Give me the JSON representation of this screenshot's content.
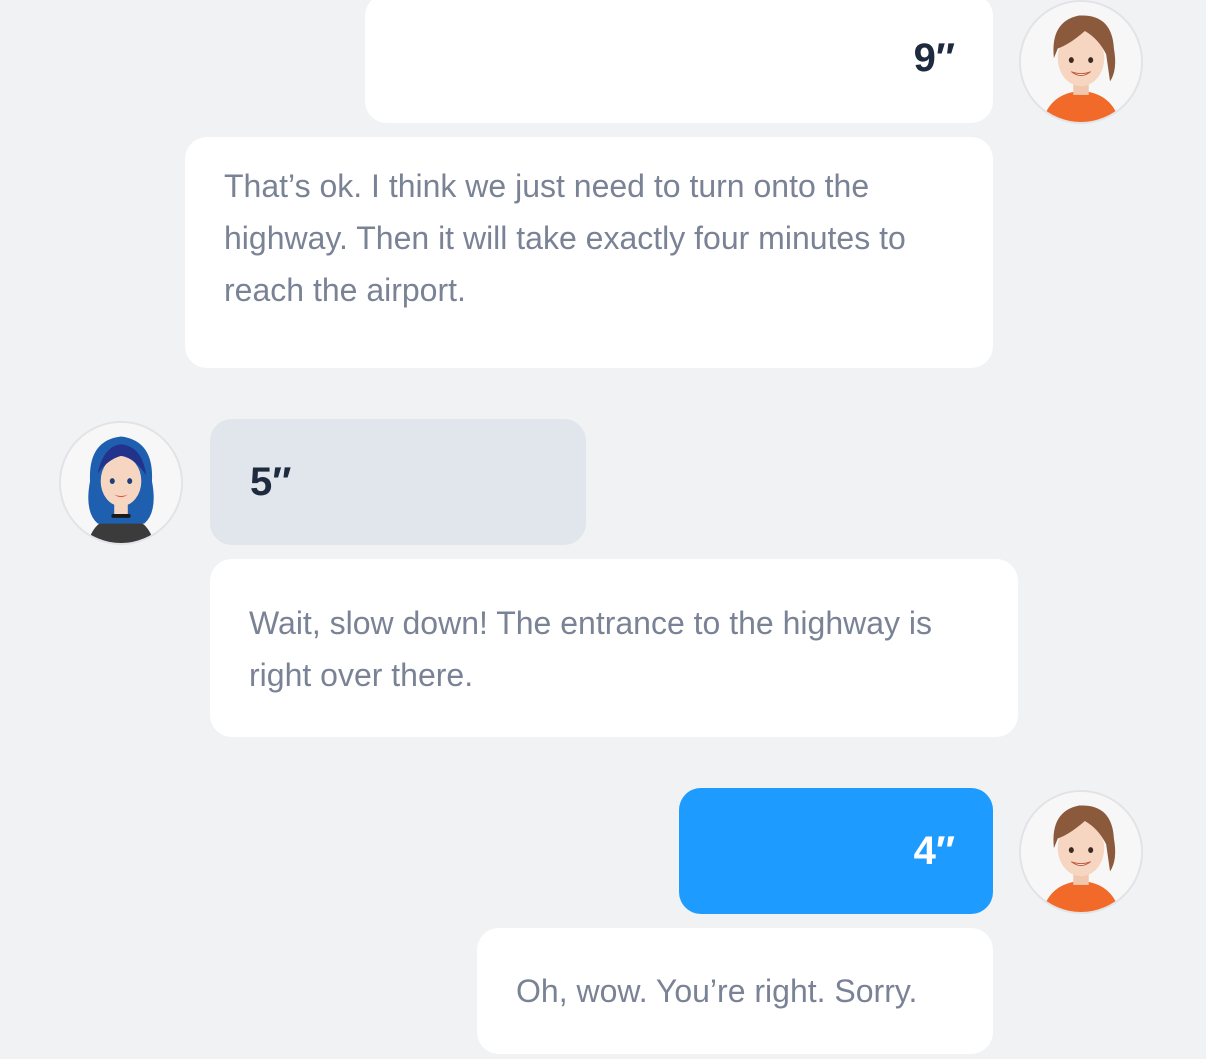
{
  "conversation": {
    "messages": [
      {
        "speaker": "man-avatar",
        "duration": "9″",
        "text": "That’s ok. I think we just need to turn onto the highway. Then it will take exactly four minutes to reach the airport."
      },
      {
        "speaker": "woman-avatar",
        "duration": "5″",
        "text": "Wait, slow down! The entrance to the highway is right over there."
      },
      {
        "speaker": "man-avatar",
        "duration": "4″",
        "text": "Oh, wow. You’re right. Sorry."
      }
    ]
  },
  "colors": {
    "background": "#f1f2f4",
    "bubble_white": "#ffffff",
    "bubble_grey": "#e1e5ec",
    "bubble_active_blue": "#1e9bff",
    "text_dark": "#1e2a3d",
    "text_muted": "#7a8396"
  }
}
